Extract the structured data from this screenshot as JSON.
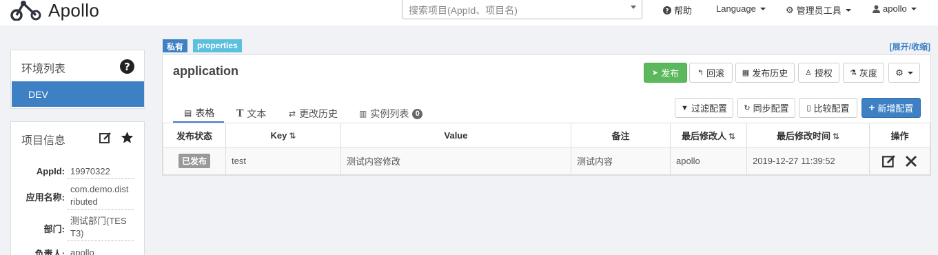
{
  "navbar": {
    "brand": "Apollo",
    "search_placeholder": "搜索项目(AppId、项目名)",
    "help": "帮助",
    "language": "Language",
    "admin_tools": "管理员工具",
    "user": "apollo"
  },
  "sidebar": {
    "env_title": "环境列表",
    "env_items": [
      "DEV"
    ],
    "project_title": "项目信息",
    "project_info": [
      {
        "label": "AppId:",
        "value": "19970322"
      },
      {
        "label": "应用名称:",
        "value": "com.demo.distributed"
      },
      {
        "label": "部门:",
        "value": "测试部门(TEST3)"
      },
      {
        "label": "负责人:",
        "value": "apollo"
      }
    ]
  },
  "namespace": {
    "tag_private": "私有",
    "tag_format": "properties",
    "expand_toggle": "[展开/收缩]",
    "name": "application",
    "actions": {
      "publish": "发布",
      "rollback": "回滚",
      "publish_history": "发布历史",
      "authorize": "授权",
      "gray": "灰度"
    },
    "tabs": {
      "table": "表格",
      "text": "文本",
      "history": "更改历史",
      "instances": "实例列表",
      "instances_count": "0"
    },
    "config_actions": {
      "filter": "过滤配置",
      "sync": "同步配置",
      "compare": "比较配置",
      "add": "新增配置"
    },
    "table": {
      "headers": {
        "status": "发布状态",
        "key": "Key",
        "value": "Value",
        "comment": "备注",
        "modifier": "最后修改人",
        "modified_time": "最后修改时间",
        "ops": "操作"
      },
      "rows": [
        {
          "status": "已发布",
          "key": "test",
          "value": "测试内容修改",
          "comment": "测试内容",
          "modifier": "apollo",
          "modified_time": "2019-12-27 11:39:52"
        }
      ]
    }
  },
  "colors": {
    "primary": "#3d81c4",
    "success": "#5cb85c",
    "tag_format": "#5bc0de",
    "background": "#f1f2f6"
  },
  "icons": [
    "apollo-logo-icon",
    "question-circle-icon",
    "gear-icon",
    "user-icon",
    "edit-icon",
    "star-icon",
    "send-icon",
    "undo-icon",
    "calendar-icon",
    "user-outline-icon",
    "flask-icon",
    "table-icon",
    "text-icon",
    "retweet-icon",
    "list-icon",
    "filter-icon",
    "refresh-icon",
    "file-icon",
    "plus-icon",
    "sort-icon",
    "close-icon"
  ]
}
